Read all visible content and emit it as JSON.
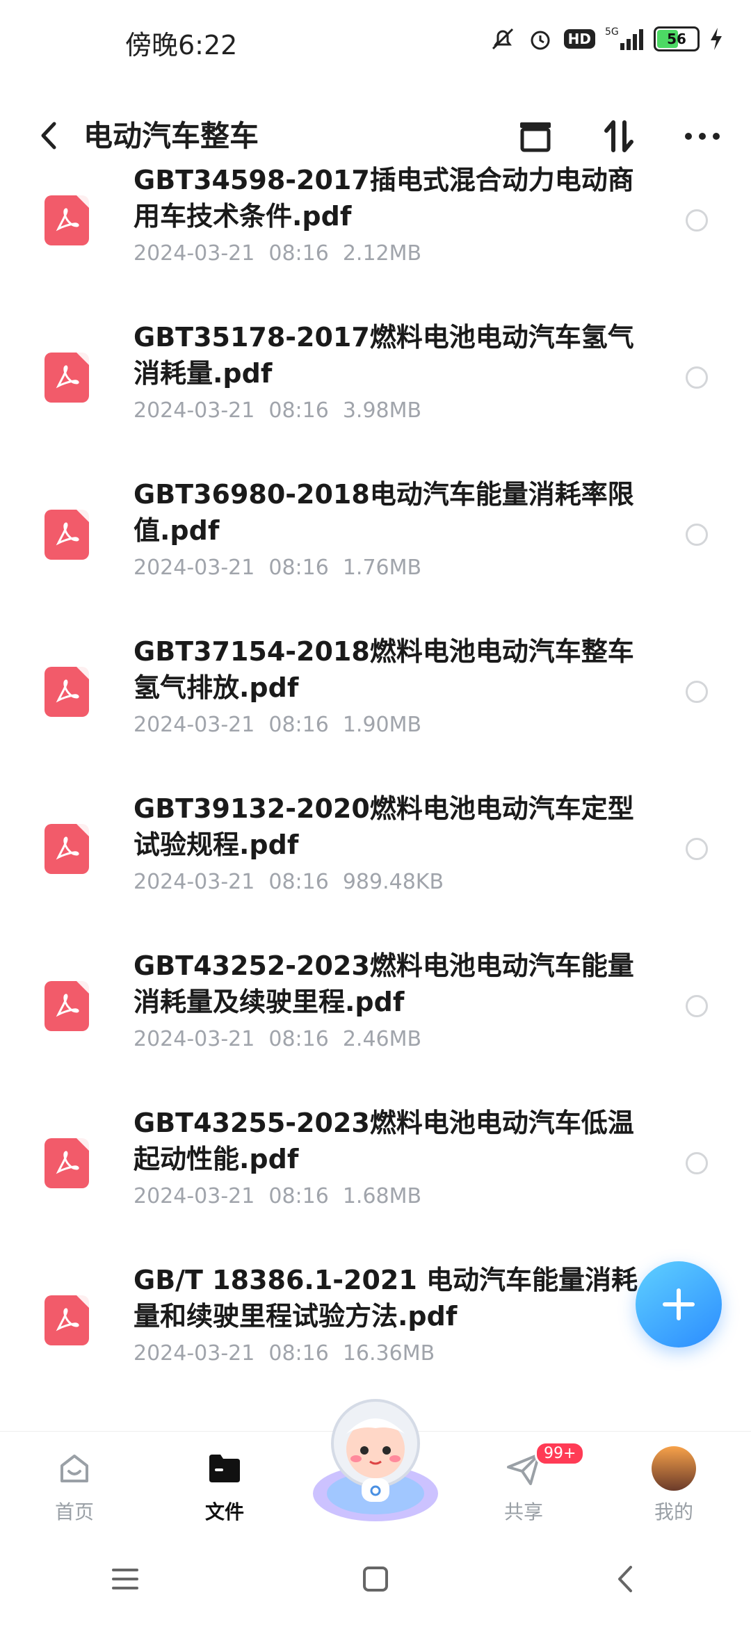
{
  "status_bar": {
    "time": "傍晚6:22",
    "network": "5G",
    "hd": "HD",
    "battery": "56",
    "battery_level": 0.56
  },
  "header": {
    "title": "电动汽车整车"
  },
  "files": [
    {
      "name": "GBT34598-2017插电式混合动力电动商用车技术条件.pdf",
      "date": "2024-03-21",
      "time": "08:16",
      "size": "2.12MB"
    },
    {
      "name": "GBT35178-2017燃料电池电动汽车氢气消耗量.pdf",
      "date": "2024-03-21",
      "time": "08:16",
      "size": "3.98MB"
    },
    {
      "name": "GBT36980-2018电动汽车能量消耗率限值.pdf",
      "date": "2024-03-21",
      "time": "08:16",
      "size": "1.76MB"
    },
    {
      "name": "GBT37154-2018燃料电池电动汽车整车氢气排放.pdf",
      "date": "2024-03-21",
      "time": "08:16",
      "size": "1.90MB"
    },
    {
      "name": "GBT39132-2020燃料电池电动汽车定型试验规程.pdf",
      "date": "2024-03-21",
      "time": "08:16",
      "size": "989.48KB"
    },
    {
      "name": "GBT43252-2023燃料电池电动汽车能量消耗量及续驶里程.pdf",
      "date": "2024-03-21",
      "time": "08:16",
      "size": "2.46MB"
    },
    {
      "name": "GBT43255-2023燃料电池电动汽车低温起动性能.pdf",
      "date": "2024-03-21",
      "time": "08:16",
      "size": "1.68MB"
    },
    {
      "name": "GB/T 18386.1-2021 电动汽车能量消耗量和续驶里程试验方法.pdf",
      "date": "2024-03-21",
      "time": "08:16",
      "size": "16.36MB"
    }
  ],
  "bottom_nav": {
    "home": "首页",
    "files": "文件",
    "share": "共享",
    "share_badge": "99+",
    "mine": "我的"
  },
  "colors": {
    "pdf": "#f25b6a",
    "fab": "#2b8cff",
    "badge": "#ff3b55"
  }
}
